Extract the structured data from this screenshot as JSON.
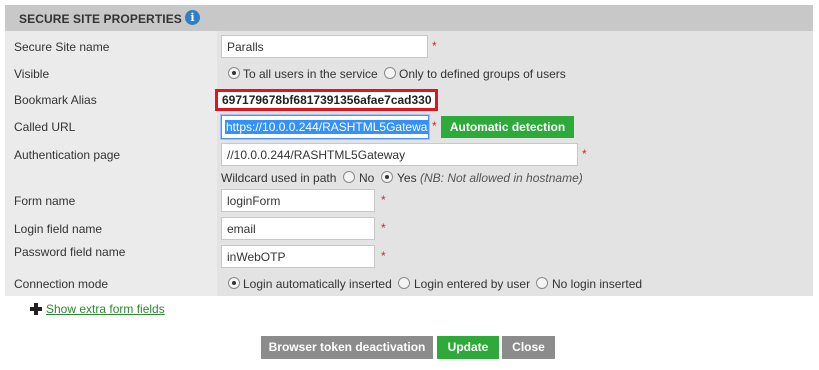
{
  "panel": {
    "title": "SECURE SITE PROPERTIES",
    "info_icon": "info-icon",
    "info_glyph": "i"
  },
  "fields": {
    "site_name": {
      "label": "Secure Site name",
      "value": "Paralls",
      "required": "*"
    },
    "visible": {
      "label": "Visible",
      "options": [
        "To all users in the service",
        "Only to defined groups of users"
      ],
      "selected": "To all users in the service"
    },
    "bookmark_alias": {
      "label": "Bookmark Alias",
      "value": "697179678bf6817391356afae7cad330"
    },
    "called_url": {
      "label": "Called URL",
      "value": "https://10.0.0.244/RASHTML5Gatewa",
      "required": "*",
      "detect_button": "Automatic detection"
    },
    "auth_page": {
      "label": "Authentication page",
      "value": "//10.0.0.244/RASHTML5Gateway",
      "required": "*"
    },
    "wildcard": {
      "label": "Wildcard used in path",
      "options": [
        "No",
        "Yes"
      ],
      "selected": "Yes",
      "note": "(NB: Not allowed in hostname)"
    },
    "form_name": {
      "label": "Form name",
      "value": "loginForm",
      "required": "*"
    },
    "login_field": {
      "label": "Login field name",
      "value": "email",
      "required": "*"
    },
    "password_field": {
      "label": "Password field name",
      "value": "inWebOTP",
      "required": "*"
    },
    "connection_mode": {
      "label": "Connection mode",
      "options": [
        "Login automatically inserted",
        "Login entered by user",
        "No login inserted"
      ],
      "selected": "Login automatically inserted"
    }
  },
  "extra": {
    "icon": "plus-icon",
    "link_label": "Show extra form fields"
  },
  "actions": {
    "deactivate_label": "Browser token deactivation",
    "update_label": "Update",
    "close_label": "Close"
  },
  "colors": {
    "accent_green": "#2eaa3a",
    "highlight_red": "#e0161f",
    "info_blue": "#2f7ec8",
    "button_grey": "#8c8c8c"
  }
}
